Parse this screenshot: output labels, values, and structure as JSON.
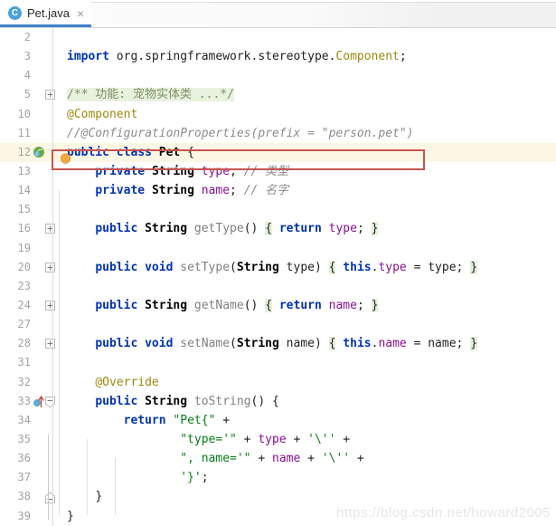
{
  "tab": {
    "title": "Pet.java",
    "icon_letter": "C",
    "close_glyph": "×"
  },
  "watermark": "https://blog.csdn.net/howard2005",
  "colors": {
    "keyword": "#0033b3",
    "string": "#067d17",
    "comment": "#8c8c8c",
    "field": "#871094",
    "annotation": "#9e880d",
    "method_unused": "#808080",
    "fold_background": "#e3f1da",
    "error_box_border": "#c75450",
    "tab_underline": "#4083c9",
    "current_line_background": "#fbf7e4",
    "bulb": "#f5a83d",
    "spring_bean_icon_green": "#68aa45",
    "override_icon_blue": "#55aed6"
  },
  "editor": {
    "lines": [
      {
        "num": "2",
        "seg": []
      },
      {
        "num": "3",
        "seg": [
          {
            "c": "kw",
            "t": "import"
          },
          {
            "c": "pl",
            "t": " org.springframework.stereotype."
          },
          {
            "c": "ann",
            "t": "Component"
          },
          {
            "c": "pl",
            "t": ";"
          }
        ]
      },
      {
        "num": "4",
        "seg": []
      },
      {
        "num": "5",
        "fold": "plus",
        "seg": [
          {
            "c": "docf",
            "t": "/** 功能: 宠物实体类 ...*/"
          }
        ]
      },
      {
        "num": "10",
        "seg": [
          {
            "c": "ann",
            "t": "@Component"
          }
        ]
      },
      {
        "num": "11",
        "boxed": true,
        "bulb": true,
        "seg": [
          {
            "c": "cmt",
            "t": "//@ConfigurationProperties(prefix = \"person.pet\")"
          }
        ]
      },
      {
        "num": "12",
        "icon": "spring-bean",
        "highlight": true,
        "seg": [
          {
            "c": "kw",
            "t": "public"
          },
          {
            "c": "pl",
            "t": " "
          },
          {
            "c": "kw",
            "t": "class"
          },
          {
            "c": "pl",
            "t": " "
          },
          {
            "c": "cls",
            "t": "Pet"
          },
          {
            "c": "pl",
            "t": " {"
          }
        ]
      },
      {
        "num": "13",
        "ind": 4,
        "seg": [
          {
            "c": "kw",
            "t": "private"
          },
          {
            "c": "pl",
            "t": " "
          },
          {
            "c": "cls",
            "t": "String"
          },
          {
            "c": "pl",
            "t": " "
          },
          {
            "c": "fld",
            "t": "type"
          },
          {
            "c": "pl",
            "t": "; "
          },
          {
            "c": "cmt",
            "t": "// 类型"
          }
        ]
      },
      {
        "num": "14",
        "ind": 4,
        "seg": [
          {
            "c": "kw",
            "t": "private"
          },
          {
            "c": "pl",
            "t": " "
          },
          {
            "c": "cls",
            "t": "String"
          },
          {
            "c": "pl",
            "t": " "
          },
          {
            "c": "fld",
            "t": "name"
          },
          {
            "c": "pl",
            "t": "; "
          },
          {
            "c": "cmt",
            "t": "// 名字"
          }
        ]
      },
      {
        "num": "15",
        "seg": []
      },
      {
        "num": "16",
        "ind": 4,
        "fold": "plus",
        "seg": [
          {
            "c": "kw",
            "t": "public"
          },
          {
            "c": "pl",
            "t": " "
          },
          {
            "c": "cls",
            "t": "String"
          },
          {
            "c": "pl",
            "t": " "
          },
          {
            "c": "mth",
            "t": "getType"
          },
          {
            "c": "pl",
            "t": "() "
          },
          {
            "c": "foldb",
            "t": "{"
          },
          {
            "c": "pl",
            "t": " "
          },
          {
            "c": "kw",
            "t": "return"
          },
          {
            "c": "pl",
            "t": " "
          },
          {
            "c": "fld",
            "t": "type"
          },
          {
            "c": "pl",
            "t": "; "
          },
          {
            "c": "foldb",
            "t": "}"
          }
        ]
      },
      {
        "num": "19",
        "seg": []
      },
      {
        "num": "20",
        "ind": 4,
        "fold": "plus",
        "seg": [
          {
            "c": "kw",
            "t": "public"
          },
          {
            "c": "pl",
            "t": " "
          },
          {
            "c": "kw",
            "t": "void"
          },
          {
            "c": "pl",
            "t": " "
          },
          {
            "c": "mth",
            "t": "setType"
          },
          {
            "c": "pl",
            "t": "("
          },
          {
            "c": "cls",
            "t": "String"
          },
          {
            "c": "pl",
            "t": " type) "
          },
          {
            "c": "foldb",
            "t": "{"
          },
          {
            "c": "pl",
            "t": " "
          },
          {
            "c": "kw",
            "t": "this"
          },
          {
            "c": "pl",
            "t": "."
          },
          {
            "c": "fld",
            "t": "type"
          },
          {
            "c": "pl",
            "t": " = type; "
          },
          {
            "c": "foldb",
            "t": "}"
          }
        ]
      },
      {
        "num": "23",
        "seg": []
      },
      {
        "num": "24",
        "ind": 4,
        "fold": "plus",
        "seg": [
          {
            "c": "kw",
            "t": "public"
          },
          {
            "c": "pl",
            "t": " "
          },
          {
            "c": "cls",
            "t": "String"
          },
          {
            "c": "pl",
            "t": " "
          },
          {
            "c": "mth",
            "t": "getName"
          },
          {
            "c": "pl",
            "t": "() "
          },
          {
            "c": "foldb",
            "t": "{"
          },
          {
            "c": "pl",
            "t": " "
          },
          {
            "c": "kw",
            "t": "return"
          },
          {
            "c": "pl",
            "t": " "
          },
          {
            "c": "fld",
            "t": "name"
          },
          {
            "c": "pl",
            "t": "; "
          },
          {
            "c": "foldb",
            "t": "}"
          }
        ]
      },
      {
        "num": "27",
        "seg": []
      },
      {
        "num": "28",
        "ind": 4,
        "fold": "plus",
        "seg": [
          {
            "c": "kw",
            "t": "public"
          },
          {
            "c": "pl",
            "t": " "
          },
          {
            "c": "kw",
            "t": "void"
          },
          {
            "c": "pl",
            "t": " "
          },
          {
            "c": "mth",
            "t": "setName"
          },
          {
            "c": "pl",
            "t": "("
          },
          {
            "c": "cls",
            "t": "String"
          },
          {
            "c": "pl",
            "t": " name) "
          },
          {
            "c": "foldb",
            "t": "{"
          },
          {
            "c": "pl",
            "t": " "
          },
          {
            "c": "kw",
            "t": "this"
          },
          {
            "c": "pl",
            "t": "."
          },
          {
            "c": "fld",
            "t": "name"
          },
          {
            "c": "pl",
            "t": " = name; "
          },
          {
            "c": "foldb",
            "t": "}"
          }
        ]
      },
      {
        "num": "31",
        "seg": []
      },
      {
        "num": "32",
        "ind": 4,
        "seg": [
          {
            "c": "ann",
            "t": "@Override"
          }
        ]
      },
      {
        "num": "33",
        "ind": 4,
        "icon": "override",
        "fold": "start",
        "seg": [
          {
            "c": "kw",
            "t": "public"
          },
          {
            "c": "pl",
            "t": " "
          },
          {
            "c": "cls",
            "t": "String"
          },
          {
            "c": "pl",
            "t": " "
          },
          {
            "c": "mth",
            "t": "toString"
          },
          {
            "c": "pl",
            "t": "() {"
          }
        ]
      },
      {
        "num": "34",
        "ind": 8,
        "seg": [
          {
            "c": "kw",
            "t": "return"
          },
          {
            "c": "pl",
            "t": " "
          },
          {
            "c": "str",
            "t": "\"Pet{\""
          },
          {
            "c": "pl",
            "t": " +"
          }
        ]
      },
      {
        "num": "35",
        "ind": 16,
        "seg": [
          {
            "c": "str",
            "t": "\"type='\""
          },
          {
            "c": "pl",
            "t": " + "
          },
          {
            "c": "fld",
            "t": "type"
          },
          {
            "c": "pl",
            "t": " + "
          },
          {
            "c": "str",
            "t": "'\\''"
          },
          {
            "c": "pl",
            "t": " +"
          }
        ]
      },
      {
        "num": "36",
        "ind": 16,
        "seg": [
          {
            "c": "str",
            "t": "\", name='\""
          },
          {
            "c": "pl",
            "t": " + "
          },
          {
            "c": "fld",
            "t": "name"
          },
          {
            "c": "pl",
            "t": " + "
          },
          {
            "c": "str",
            "t": "'\\''"
          },
          {
            "c": "pl",
            "t": " +"
          }
        ]
      },
      {
        "num": "37",
        "ind": 16,
        "seg": [
          {
            "c": "str",
            "t": "'}'"
          },
          {
            "c": "pl",
            "t": ";"
          }
        ]
      },
      {
        "num": "38",
        "ind": 4,
        "fold": "end",
        "seg": [
          {
            "c": "pl",
            "t": "}"
          }
        ]
      },
      {
        "num": "39",
        "seg": [
          {
            "c": "pl",
            "t": "}"
          }
        ]
      }
    ]
  }
}
